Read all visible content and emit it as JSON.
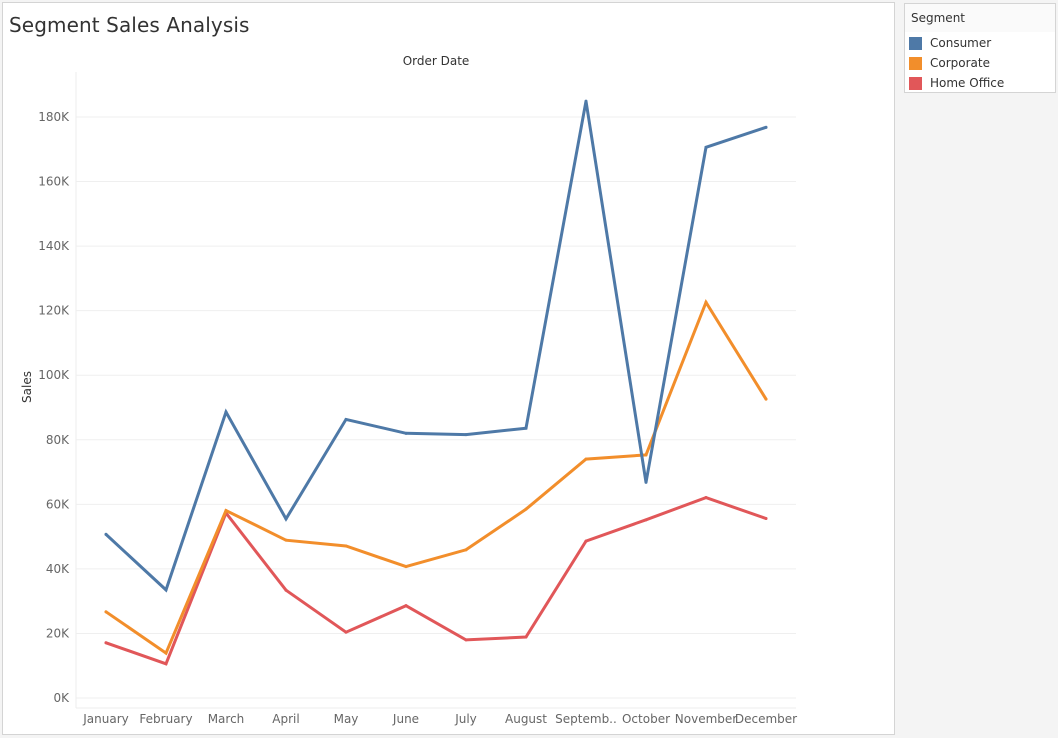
{
  "dashboard": {
    "title": "Segment Sales Analysis"
  },
  "legend": {
    "title": "Segment",
    "items": [
      {
        "label": "Consumer",
        "color": "#4e79a7"
      },
      {
        "label": "Corporate",
        "color": "#f28e2b"
      },
      {
        "label": "Home Office",
        "color": "#e15759"
      }
    ]
  },
  "chart_data": {
    "type": "line",
    "title": "Segment Sales Analysis",
    "column_header": "Order Date",
    "xlabel": "Order Date",
    "ylabel": "Sales",
    "categories": [
      "January",
      "February",
      "March",
      "April",
      "May",
      "June",
      "July",
      "August",
      "September",
      "October",
      "November",
      "December"
    ],
    "category_labels": [
      "January",
      "February",
      "March",
      "April",
      "May",
      "June",
      "July",
      "August",
      "Septemb..",
      "October",
      "November",
      "December"
    ],
    "ylim": [
      0,
      190000
    ],
    "yticks": [
      0,
      20000,
      40000,
      60000,
      80000,
      100000,
      120000,
      140000,
      160000,
      180000
    ],
    "ytick_labels": [
      "0K",
      "20K",
      "40K",
      "60K",
      "80K",
      "100K",
      "120K",
      "140K",
      "160K",
      "180K"
    ],
    "grid": true,
    "legend_position": "right",
    "series": [
      {
        "name": "Consumer",
        "color": "#4e79a7",
        "values": [
          50700,
          33500,
          88600,
          55500,
          86300,
          82000,
          81600,
          83600,
          184900,
          66800,
          170600,
          176800
        ]
      },
      {
        "name": "Corporate",
        "color": "#f28e2b",
        "values": [
          26700,
          13900,
          58100,
          48900,
          47100,
          40700,
          45900,
          58500,
          74000,
          75300,
          122600,
          92600
        ]
      },
      {
        "name": "Home Office",
        "color": "#e15759",
        "values": [
          17100,
          10600,
          57300,
          33400,
          20400,
          28600,
          18000,
          18900,
          48600,
          55200,
          62100,
          55600
        ]
      }
    ]
  }
}
